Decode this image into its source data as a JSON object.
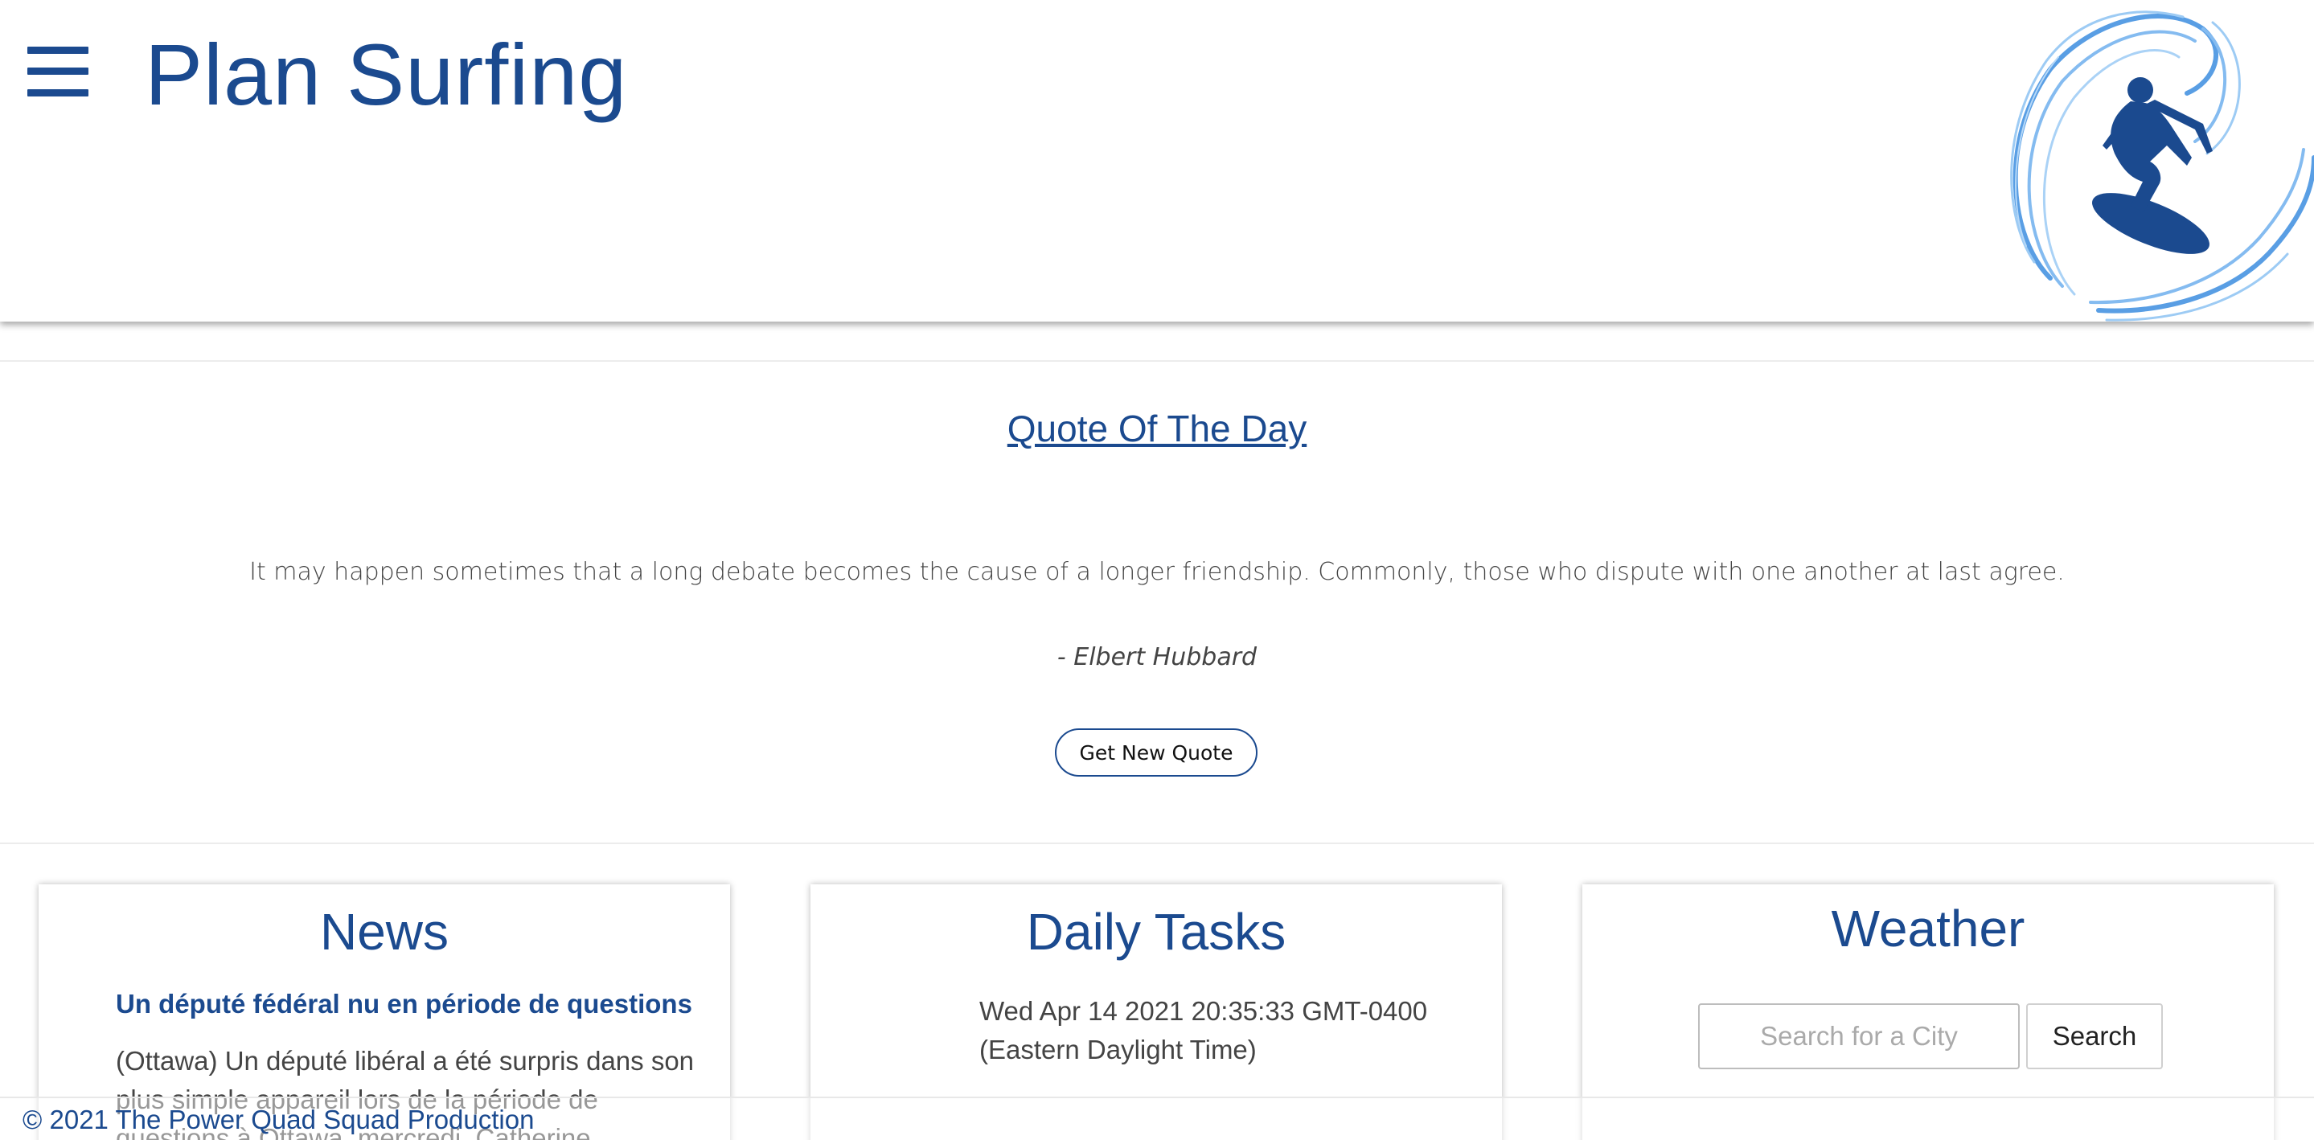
{
  "header": {
    "menu_icon": "hamburger-menu-icon",
    "title": "Plan Surfing",
    "logo_icon": "surfer-wave-logo",
    "brand_color": "#1b4a8f"
  },
  "quote": {
    "heading": "Quote Of The Day",
    "text": "It may happen sometimes that a long debate becomes the cause of a longer friendship. Commonly, those who dispute with one another at last agree.",
    "author": "- Elbert Hubbard",
    "button_label": "Get New Quote"
  },
  "news": {
    "title": "News",
    "headline": "Un député fédéral nu en période de questions",
    "body": "(Ottawa) Un député libéral a été surpris dans son plus simple appareil lors de la période de questions à Ottawa, mercredi. Catherine"
  },
  "tasks": {
    "title": "Daily Tasks",
    "datetime": "Wed Apr 14 2021 20:35:33 GMT-0400 (Eastern Daylight Time)"
  },
  "weather": {
    "title": "Weather",
    "search_placeholder": "Search for a City",
    "search_value": "",
    "search_button": "Search"
  },
  "footer": {
    "text": "© 2021 The Power Quad Squad Production"
  }
}
